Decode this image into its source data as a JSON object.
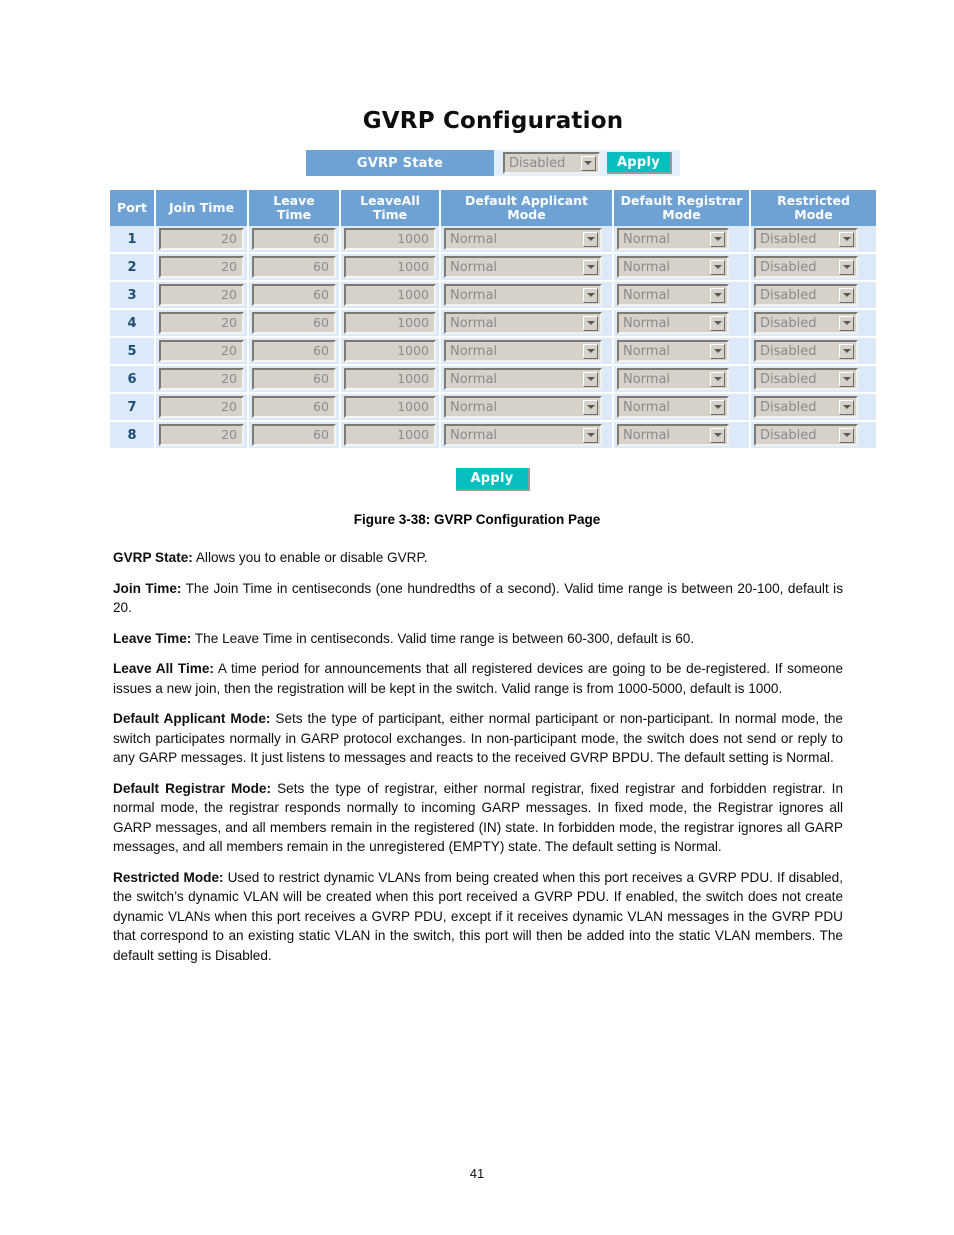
{
  "screenshot": {
    "title": "GVRP Configuration",
    "state_bar": {
      "label": "GVRP State",
      "select_value": "Disabled",
      "apply_label": "Apply"
    },
    "table": {
      "headers": [
        "Port",
        "Join Time",
        "Leave\nTime",
        "LeaveAll\nTime",
        "Default Applicant\nMode",
        "Default Registrar\nMode",
        "Restricted\nMode"
      ],
      "headers_flat": {
        "port": "Port",
        "join_time": "Join Time",
        "leave_time_l1": "Leave",
        "leave_time_l2": "Time",
        "leaveall_time_l1": "LeaveAll",
        "leaveall_time_l2": "Time",
        "applicant_l1": "Default Applicant",
        "applicant_l2": "Mode",
        "registrar_l1": "Default Registrar",
        "registrar_l2": "Mode",
        "restricted_l1": "Restricted",
        "restricted_l2": "Mode"
      },
      "rows": [
        {
          "port": "1",
          "join_time": "20",
          "leave_time": "60",
          "leaveall_time": "1000",
          "applicant_mode": "Normal",
          "registrar_mode": "Normal",
          "restricted_mode": "Disabled"
        },
        {
          "port": "2",
          "join_time": "20",
          "leave_time": "60",
          "leaveall_time": "1000",
          "applicant_mode": "Normal",
          "registrar_mode": "Normal",
          "restricted_mode": "Disabled"
        },
        {
          "port": "3",
          "join_time": "20",
          "leave_time": "60",
          "leaveall_time": "1000",
          "applicant_mode": "Normal",
          "registrar_mode": "Normal",
          "restricted_mode": "Disabled"
        },
        {
          "port": "4",
          "join_time": "20",
          "leave_time": "60",
          "leaveall_time": "1000",
          "applicant_mode": "Normal",
          "registrar_mode": "Normal",
          "restricted_mode": "Disabled"
        },
        {
          "port": "5",
          "join_time": "20",
          "leave_time": "60",
          "leaveall_time": "1000",
          "applicant_mode": "Normal",
          "registrar_mode": "Normal",
          "restricted_mode": "Disabled"
        },
        {
          "port": "6",
          "join_time": "20",
          "leave_time": "60",
          "leaveall_time": "1000",
          "applicant_mode": "Normal",
          "registrar_mode": "Normal",
          "restricted_mode": "Disabled"
        },
        {
          "port": "7",
          "join_time": "20",
          "leave_time": "60",
          "leaveall_time": "1000",
          "applicant_mode": "Normal",
          "registrar_mode": "Normal",
          "restricted_mode": "Disabled"
        },
        {
          "port": "8",
          "join_time": "20",
          "leave_time": "60",
          "leaveall_time": "1000",
          "applicant_mode": "Normal",
          "registrar_mode": "Normal",
          "restricted_mode": "Disabled"
        }
      ]
    },
    "bottom_apply_label": "Apply",
    "colors": {
      "header_blue": "#6fa2d4",
      "row_blue": "#dce9f8",
      "apply_teal": "#07bfbf",
      "control_gray": "#d6d2ca",
      "port_number_blue": "#1f4e79"
    }
  },
  "figure_caption": "Figure 3-38: GVRP Configuration Page",
  "paragraphs": [
    {
      "term": "GVRP State:",
      "text": " Allows you to enable or disable GVRP."
    },
    {
      "term": "Join Time:",
      "text": " The Join Time in centiseconds (one hundredths of a second). Valid time range is between 20-100, default is 20."
    },
    {
      "term": "Leave Time:",
      "text": " The Leave Time in centiseconds. Valid time range is between 60-300, default is 60."
    },
    {
      "term": "Leave All Time:",
      "text": " A time period for announcements that all registered devices are going to be de-registered. If someone issues a new join, then the registration will be kept in the switch. Valid range is from 1000-5000, default is 1000."
    },
    {
      "term": "Default Applicant Mode:",
      "text": " Sets the type of participant, either normal participant or non-participant. In normal mode, the switch participates normally in GARP protocol exchanges. In non-participant mode, the switch does not send or reply to any GARP messages. It just listens to messages and reacts to the received GVRP BPDU. The default setting is Normal."
    },
    {
      "term": "Default Registrar Mode:",
      "text": " Sets the type of registrar, either normal registrar, fixed registrar and forbidden registrar. In normal mode, the registrar responds normally to incoming GARP messages. In fixed mode, the Registrar ignores all GARP messages, and all members remain in the registered (IN) state. In forbidden mode, the registrar ignores all GARP messages, and all members remain in the unregistered (EMPTY) state. The default setting is Normal."
    },
    {
      "term": "Restricted Mode:",
      "text": " Used to restrict dynamic VLANs from being created when this port receives a GVRP PDU. If disabled, the switch’s dynamic VLAN will be created when this port received a GVRP PDU. If enabled, the switch does not create dynamic VLANs when this port receives a GVRP PDU, except if it receives dynamic VLAN messages in the GVRP PDU that correspond to an existing static VLAN in the switch, this port will then be added into the static VLAN members. The default setting is Disabled."
    }
  ],
  "page_number": "41"
}
